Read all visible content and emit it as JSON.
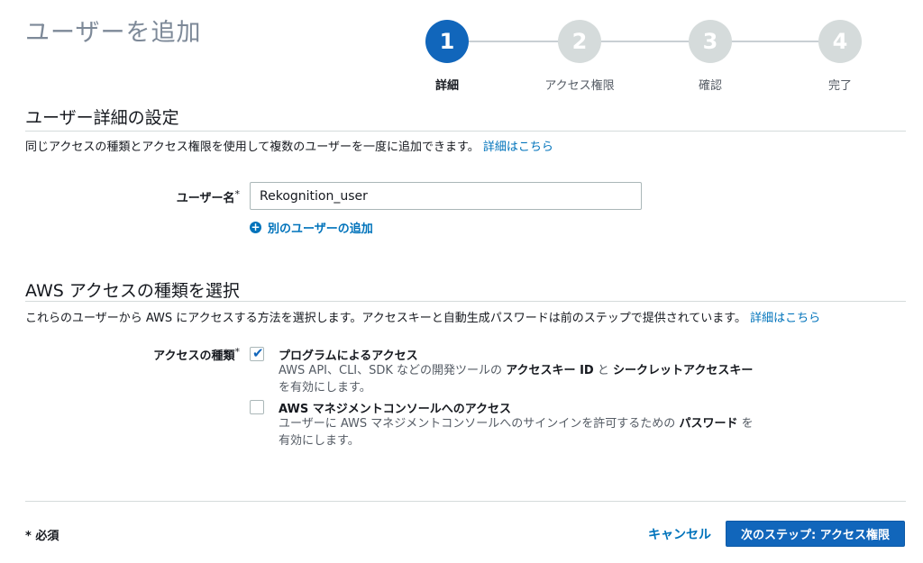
{
  "header": {
    "title": "ユーザーを追加"
  },
  "stepper": {
    "steps": [
      {
        "number": "1",
        "label": "詳細",
        "active": true
      },
      {
        "number": "2",
        "label": "アクセス権限",
        "active": false
      },
      {
        "number": "3",
        "label": "確認",
        "active": false
      },
      {
        "number": "4",
        "label": "完了",
        "active": false
      }
    ]
  },
  "details": {
    "title": "ユーザー詳細の設定",
    "description": "同じアクセスの種類とアクセス権限を使用して複数のユーザーを一度に追加できます。",
    "learn_more": "詳細はこちら",
    "username_label": "ユーザー名",
    "required_mark": "*",
    "username_value": "Rekognition_user",
    "add_user_label": "別のユーザーの追加"
  },
  "access": {
    "title": "AWS アクセスの種類を選択",
    "description": "これらのユーザーから AWS にアクセスする方法を選択します。アクセスキーと自動生成パスワードは前のステップで提供されています。",
    "learn_more": "詳細はこちら",
    "type_label": "アクセスの種類",
    "options": [
      {
        "title": "プログラムによるアクセス",
        "checked": true,
        "desc_part1": "AWS API、CLI、SDK などの開発ツールの",
        "desc_bold1": "アクセスキー ID",
        "desc_part2": "と",
        "desc_bold2": "シークレットアクセスキー",
        "desc_part3": "を有効にします。"
      },
      {
        "title": "AWS マネジメントコンソールへのアクセス",
        "checked": false,
        "desc_part1": "ユーザーに AWS マネジメントコンソールへのサインインを許可するための",
        "desc_bold1": "パスワード",
        "desc_part2": "を",
        "desc_part3": "有効にします。"
      }
    ]
  },
  "footer": {
    "required_note": "* 必須",
    "cancel_label": "キャンセル",
    "next_label": "次のステップ: アクセス権限"
  },
  "colors": {
    "accent": "#1166bb",
    "link": "#0073bb",
    "step_inactive": "#d5dbdb"
  },
  "icons": {
    "add": "plus-circle-icon",
    "check": "check-icon"
  }
}
